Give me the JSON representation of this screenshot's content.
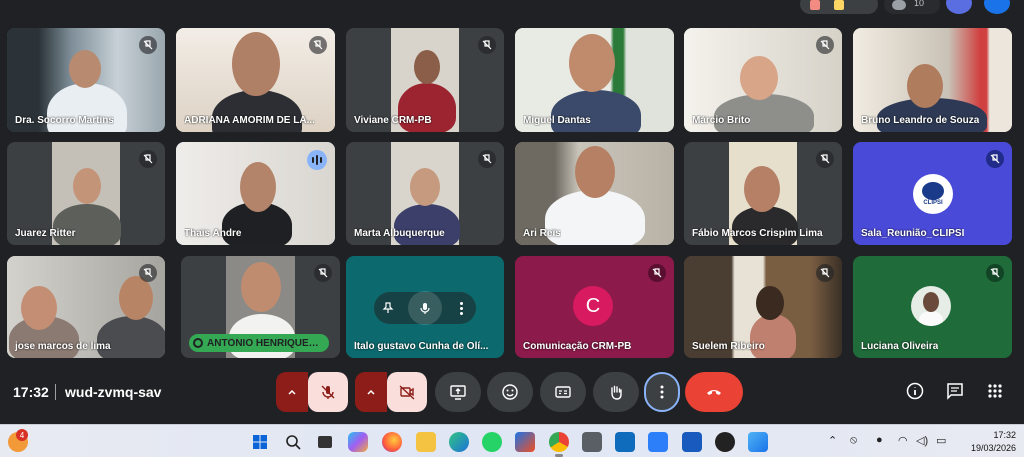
{
  "participants": [
    {
      "name": "Dra. Socorro Martins",
      "muted": true
    },
    {
      "name": "ADRIANA AMORIM DE LA...",
      "muted": true
    },
    {
      "name": "Viviane CRM-PB",
      "muted": true
    },
    {
      "name": "Miguel Dantas",
      "muted": false
    },
    {
      "name": "Márcio Brito",
      "muted": true
    },
    {
      "name": "Bruno Leandro de Souza",
      "muted": false
    },
    {
      "name": "Juarez Ritter",
      "muted": true
    },
    {
      "name": "Thais Andre",
      "muted": false
    },
    {
      "name": "Marta Albuquerque",
      "muted": true
    },
    {
      "name": "Ari Reis",
      "muted": false
    },
    {
      "name": "Fábio Marcos Crispim Lima",
      "muted": true
    },
    {
      "name": "Sala_Reunião_CLIPSI",
      "muted": true
    },
    {
      "name": "jose marcos de lima",
      "muted": true
    },
    {
      "name": "ANTÔNIO HENRIQUES ...",
      "muted": true
    },
    {
      "name": "Ítalo gustavo Cunha de Olí...",
      "muted": false
    },
    {
      "name": "Comunicação CRM-PB",
      "muted": true
    },
    {
      "name": "Suelem Ribeiro",
      "muted": true
    },
    {
      "name": "Luciana Oliveira",
      "muted": true
    }
  ],
  "clipsi_logo_text": "CLIPSI",
  "comunicacao_initial": "C",
  "meeting": {
    "time": "17:32",
    "code": "wud-zvmq-sav"
  },
  "top_count": "10",
  "taskbar": {
    "notification_count": "4",
    "time": "17:32",
    "date": "19/03/2026"
  },
  "colors": {
    "background": "#202124",
    "tile": "#3c4043",
    "accent_blue": "#8ab4f8",
    "end_red": "#ea4335",
    "muted_btn_bg": "#f9dedc",
    "muted_caret": "#8c1d18",
    "clipsi_tile": "#4a4ad8",
    "comunicacao_tile": "#8c1a4a",
    "italo_tile": "#0c6a6e",
    "luciana_tile": "#1f6b3a",
    "pin_green": "#34a853"
  }
}
